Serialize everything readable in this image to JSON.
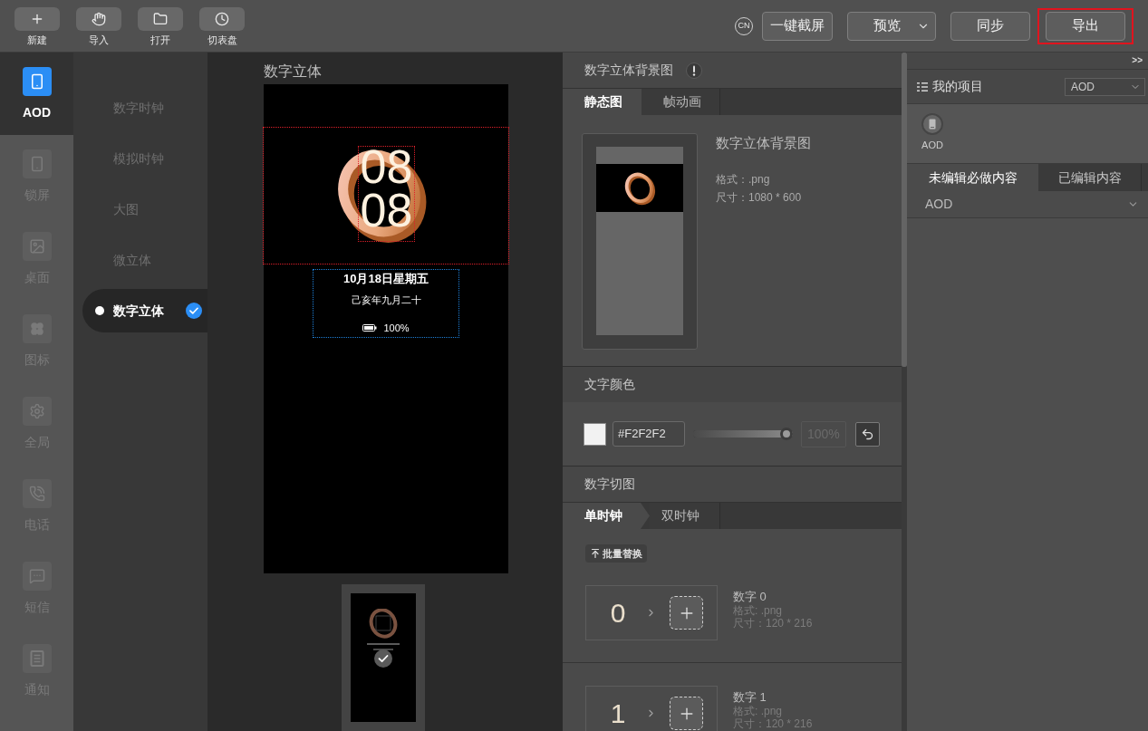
{
  "toolbar": {
    "tools": [
      {
        "label": "新建"
      },
      {
        "label": "导入"
      },
      {
        "label": "打开"
      },
      {
        "label": "切表盘"
      }
    ],
    "language": "CN",
    "actions": [
      {
        "label": "一键截屏",
        "kind": "button",
        "highlighted": false
      },
      {
        "label": "预览",
        "kind": "dropdown",
        "highlighted": false
      },
      {
        "label": "同步",
        "kind": "button",
        "highlighted": false
      },
      {
        "label": "导出",
        "kind": "button",
        "highlighted": true
      }
    ]
  },
  "categories": [
    {
      "label": "AOD",
      "selected": true
    },
    {
      "label": "锁屏",
      "selected": false
    },
    {
      "label": "桌面",
      "selected": false
    },
    {
      "label": "图标",
      "selected": false
    },
    {
      "label": "全局",
      "selected": false
    },
    {
      "label": "电话",
      "selected": false
    },
    {
      "label": "短信",
      "selected": false
    },
    {
      "label": "通知",
      "selected": false
    }
  ],
  "styles": [
    {
      "label": "数字时钟",
      "selected": false
    },
    {
      "label": "模拟时钟",
      "selected": false
    },
    {
      "label": "大图",
      "selected": false
    },
    {
      "label": "微立体",
      "selected": false
    },
    {
      "label": "数字立体",
      "selected": true
    }
  ],
  "canvas": {
    "title": "数字立体",
    "preview": {
      "hours": "08",
      "minutes": "08",
      "date": "10月18日星期五",
      "lunar": "己亥年九月二十",
      "battery": "100%"
    }
  },
  "background_image": {
    "title": "数字立体背景图",
    "tabs": [
      {
        "label": "静态图",
        "selected": true
      },
      {
        "label": "帧动画",
        "selected": false
      }
    ],
    "name": "数字立体背景图",
    "format": "格式：.png",
    "size": "尺寸：1080 * 600"
  },
  "text_color": {
    "title": "文字颜色",
    "value": "#F2F2F2",
    "color": "#f2f2f2",
    "level": 1,
    "opacity": "100%",
    "opacity_disabled": true
  },
  "digit_images": {
    "title": "数字切图",
    "tabs": [
      {
        "label": "单时钟",
        "selected": true
      },
      {
        "label": "双时钟",
        "selected": false
      }
    ],
    "batch_button": "批量替换",
    "digits": [
      {
        "glyph": "0",
        "name": "数字 0",
        "format": "格式: .png",
        "size": "尺寸：120 * 216"
      },
      {
        "glyph": "1",
        "name": "数字 1",
        "format": "格式: .png",
        "size": "尺寸：120 * 216"
      }
    ]
  },
  "project_panel": {
    "collapse": ">>",
    "title": "我的项目",
    "select": "AOD",
    "items": [
      {
        "label": "AOD"
      }
    ],
    "tabs": [
      {
        "label": "未编辑必做内容",
        "selected": true
      },
      {
        "label": "已编辑内容",
        "selected": false
      }
    ],
    "groups": [
      {
        "label": "AOD"
      }
    ]
  }
}
